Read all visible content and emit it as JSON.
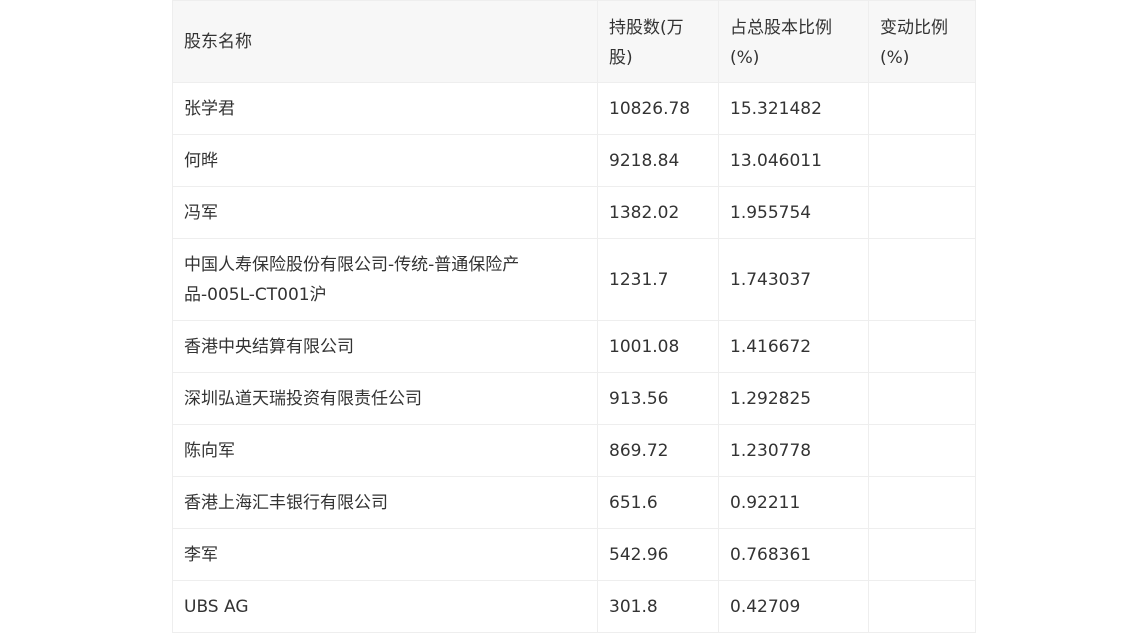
{
  "table": {
    "headers": {
      "name": "股东名称",
      "shares": "持股数(万股)",
      "ratio": "占总股本比例(%)",
      "change": "变动比例(%)"
    },
    "rows": [
      {
        "name": "张学君",
        "shares": "10826.78",
        "ratio": "15.321482",
        "change": ""
      },
      {
        "name": "何晔",
        "shares": "9218.84",
        "ratio": "13.046011",
        "change": ""
      },
      {
        "name": "冯军",
        "shares": "1382.02",
        "ratio": "1.955754",
        "change": ""
      },
      {
        "name": "中国人寿保险股份有限公司-传统-普通保险产品-005L-CT001沪",
        "shares": "1231.7",
        "ratio": "1.743037",
        "change": ""
      },
      {
        "name": "香港中央结算有限公司",
        "shares": "1001.08",
        "ratio": "1.416672",
        "change": ""
      },
      {
        "name": "深圳弘道天瑞投资有限责任公司",
        "shares": "913.56",
        "ratio": "1.292825",
        "change": ""
      },
      {
        "name": "陈向军",
        "shares": "869.72",
        "ratio": "1.230778",
        "change": ""
      },
      {
        "name": "香港上海汇丰银行有限公司",
        "shares": "651.6",
        "ratio": "0.92211",
        "change": ""
      },
      {
        "name": "李军",
        "shares": "542.96",
        "ratio": "0.768361",
        "change": ""
      },
      {
        "name": "UBS AG",
        "shares": "301.8",
        "ratio": "0.42709",
        "change": ""
      }
    ]
  }
}
